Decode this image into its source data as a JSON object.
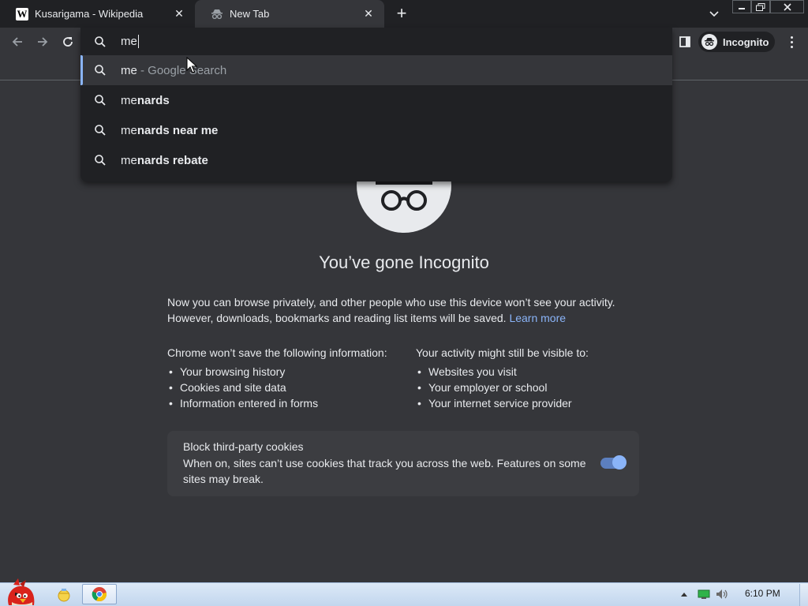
{
  "tabs": [
    {
      "title": "Kusarigama - Wikipedia",
      "favicon": "wikipedia-w-icon",
      "favicon_letter": "W",
      "active": false
    },
    {
      "title": "New Tab",
      "favicon": "incognito-icon",
      "active": true
    }
  ],
  "toolbar": {
    "profile_label": "Incognito"
  },
  "omnibox": {
    "query": "me",
    "suggestions": [
      {
        "typed": "me",
        "rest": "",
        "suffix": " - Google Search",
        "selected": true
      },
      {
        "typed": "me",
        "rest": "nards",
        "suffix": "",
        "selected": false
      },
      {
        "typed": "me",
        "rest": "nards near me",
        "suffix": "",
        "selected": false
      },
      {
        "typed": "me",
        "rest": "nards rebate",
        "suffix": "",
        "selected": false
      }
    ]
  },
  "incognito": {
    "headline": "You’ve gone Incognito",
    "intro_text": "Now you can browse privately, and other people who use this device won’t see your activity. However, downloads, bookmarks and reading list items will be saved.",
    "learn_more": "Learn more",
    "left_column": {
      "heading": "Chrome won’t save the following information:",
      "items": [
        "Your browsing history",
        "Cookies and site data",
        "Information entered in forms"
      ]
    },
    "right_column": {
      "heading": "Your activity might still be visible to:",
      "items": [
        "Websites you visit",
        "Your employer or school",
        "Your internet service provider"
      ]
    },
    "cookie_card": {
      "title": "Block third-party cookies",
      "description": "When on, sites can’t use cookies that track you across the web. Features on some sites may break.",
      "toggle_on": true
    }
  },
  "taskbar": {
    "clock": "6:10 PM"
  },
  "colors": {
    "page_bg": "#35363a",
    "tabstrip_bg": "#202124",
    "link": "#8ab4f8",
    "text": "#e8eaed"
  }
}
